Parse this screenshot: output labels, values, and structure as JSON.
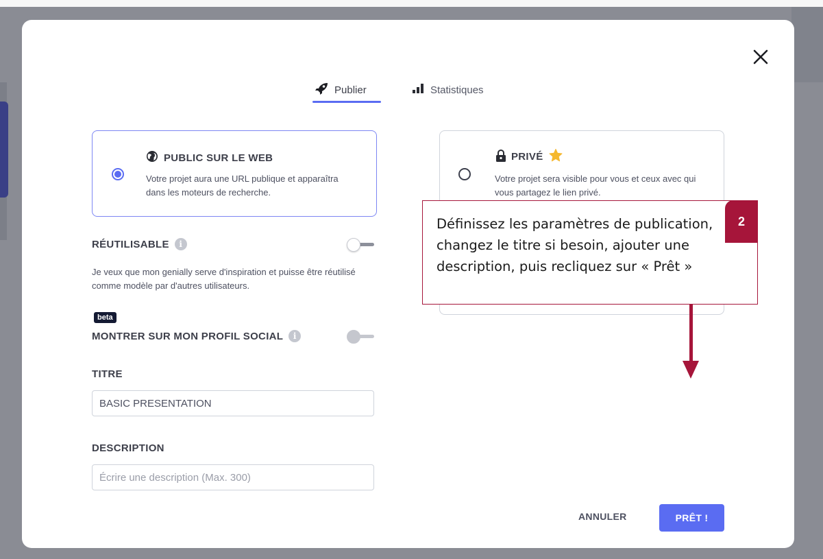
{
  "tabs": [
    {
      "label": "Publier",
      "icon": "rocket-icon",
      "active": true
    },
    {
      "label": "Statistiques",
      "icon": "bar-chart-icon",
      "active": false
    }
  ],
  "visibility_options": {
    "public": {
      "title": "PUBLIC SUR LE WEB",
      "icon": "globe-icon",
      "description": "Votre projet aura une URL publique et apparaîtra dans les moteurs de recherche.",
      "selected": true
    },
    "private": {
      "title": "PRIVÉ",
      "icon": "lock-icon",
      "premium_icon": "star-icon",
      "description": "Votre projet sera visible pour vous et ceux avec qui vous partagez le lien privé.",
      "selected": false
    }
  },
  "reusable": {
    "label": "RÉUTILISABLE",
    "help": "Je veux que mon genially serve d'inspiration et puisse être réutilisé comme modèle par d'autres utilisateurs.",
    "enabled": false
  },
  "social_profile": {
    "badge": "beta",
    "label": "MONTRER SUR MON PROFIL SOCIAL",
    "enabled": false
  },
  "title_field": {
    "label": "TITRE",
    "value": "BASIC PRESENTATION"
  },
  "description_field": {
    "label": "DESCRIPTION",
    "value": "",
    "placeholder": "Écrire une description (Max. 300)"
  },
  "actions": {
    "cancel": "ANNULER",
    "ready": "PRÊT !"
  },
  "tutorial_callout": {
    "step": "2",
    "text": "Définissez les paramètres de publication, changez le titre si besoin, ajouter une description, puis recliquez sur « Prêt »"
  },
  "colors": {
    "accent": "#5a6cf2",
    "callout": "#a6153a",
    "star": "#f5b82e"
  }
}
